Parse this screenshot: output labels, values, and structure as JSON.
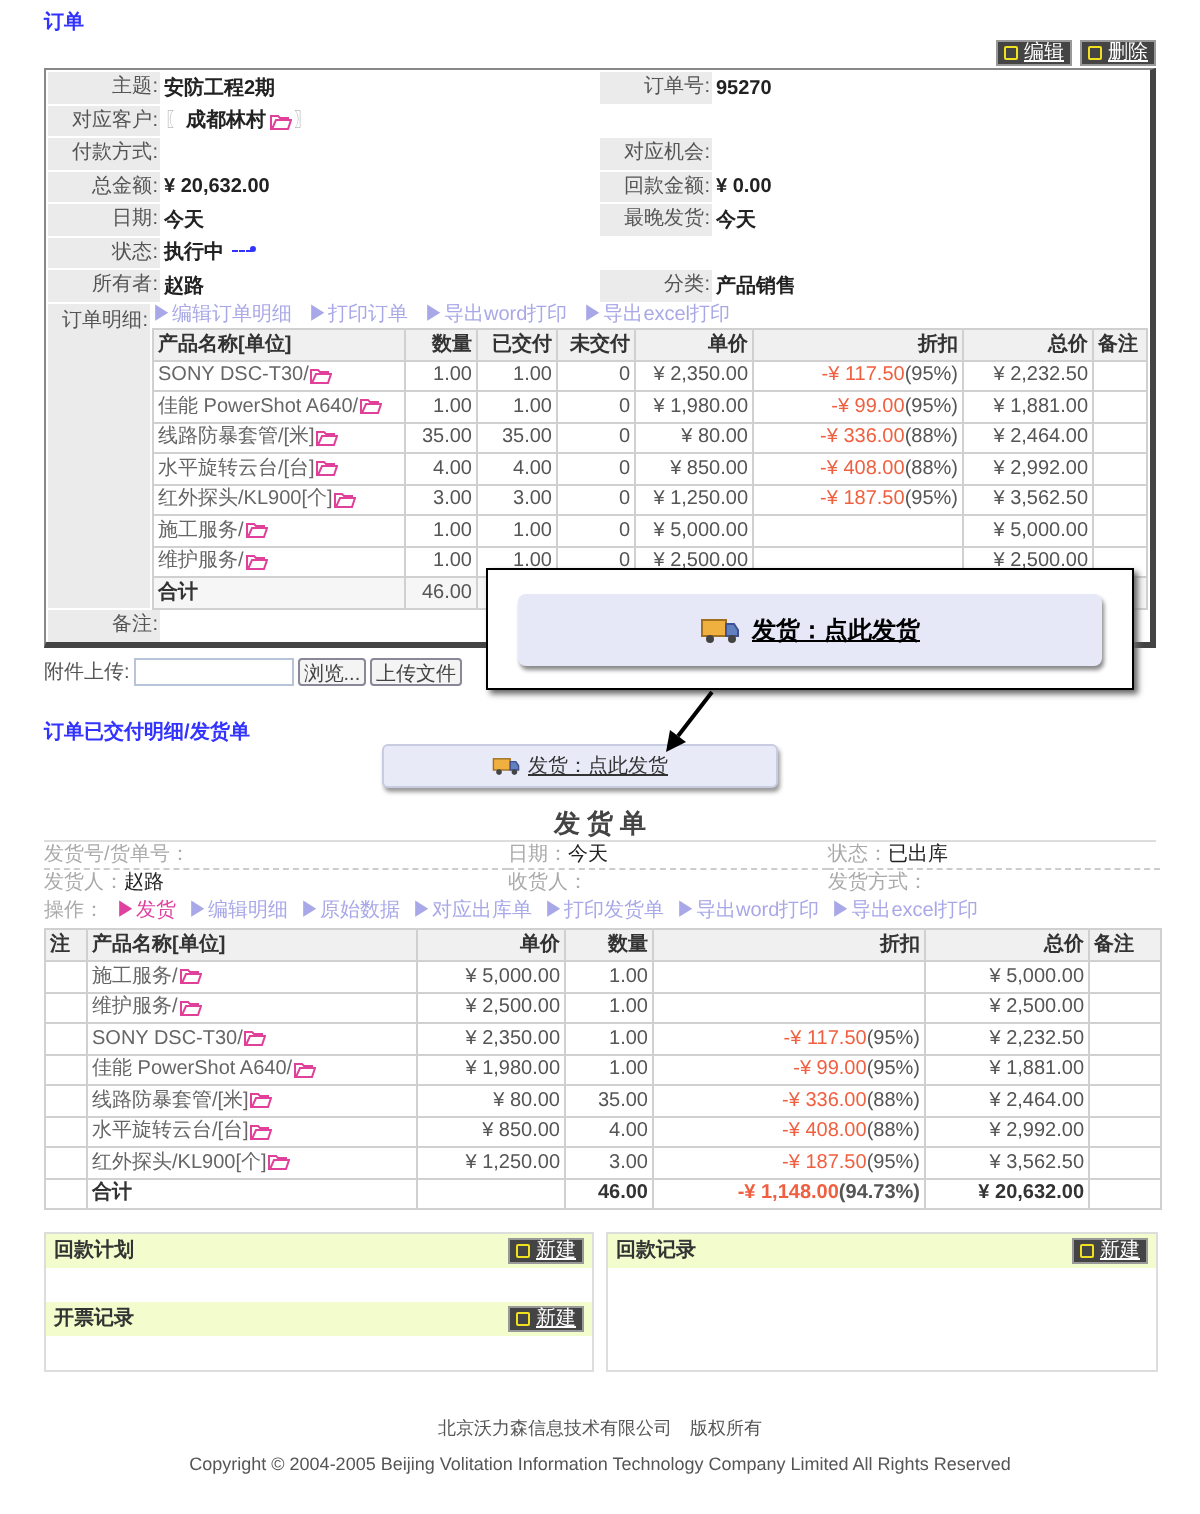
{
  "page_title": "订单",
  "toolbar": [
    {
      "label": "编辑"
    },
    {
      "label": "删除"
    }
  ],
  "order_fields": [
    {
      "cells": [
        {
          "kind": "text",
          "label": "主题:",
          "value": "安防工程2期"
        },
        {
          "kind": "text",
          "label": "订单号:",
          "value": "95270"
        }
      ]
    },
    {
      "cells": [
        {
          "kind": "customer",
          "label": "对应客户:",
          "value": "成都林村",
          "open": "〖",
          "close": "〗"
        }
      ]
    },
    {
      "cells": [
        {
          "kind": "text",
          "label": "付款方式:"
        },
        {
          "kind": "text",
          "label": "对应机会:"
        }
      ]
    },
    {
      "cells": [
        {
          "kind": "text",
          "label": "总金额:",
          "value": "¥ 20,632.00"
        },
        {
          "kind": "text",
          "label": "回款金额:",
          "value": "¥ 0.00"
        }
      ]
    },
    {
      "cells": [
        {
          "kind": "text",
          "label": "日期:",
          "value": "今天"
        },
        {
          "kind": "text",
          "label": "最晚发货:",
          "value": "今天"
        }
      ]
    },
    {
      "cells": [
        {
          "kind": "status",
          "label": "状态:",
          "value": "执行中"
        }
      ]
    },
    {
      "cells": [
        {
          "kind": "text",
          "label": "所有者:",
          "value": "赵路"
        },
        {
          "kind": "text",
          "label": "分类:",
          "value": "产品销售"
        }
      ]
    }
  ],
  "order_details": {
    "label": "订单明细:",
    "links": [
      "▶编辑订单明细",
      "▶打印订单",
      "▶导出word打印",
      "▶导出excel打印"
    ],
    "columns": [
      "**产品名称**[单位]",
      "数量",
      "已交付",
      "未交付",
      "单价",
      "折扣",
      "总价",
      "备注"
    ],
    "rows": [
      {
        "name": "SONY DSC-T30/",
        "qty": "1.00",
        "delivered": "1.00",
        "undelivered": "0",
        "price": "¥ 2,350.00",
        "discount": "-¥ 117.50",
        "pct": "(95%)",
        "total": "¥ 2,232.50"
      },
      {
        "name": "佳能  PowerShot A640/",
        "qty": "1.00",
        "delivered": "1.00",
        "undelivered": "0",
        "price": "¥ 1,980.00",
        "discount": "-¥ 99.00",
        "pct": "(95%)",
        "total": "¥ 1,881.00"
      },
      {
        "name": "线路防暴套管/[米]",
        "qty": "35.00",
        "delivered": "35.00",
        "undelivered": "0",
        "price": "¥ 80.00",
        "discount": "-¥ 336.00",
        "pct": "(88%)",
        "total": "¥ 2,464.00"
      },
      {
        "name": "水平旋转云台/[台]",
        "qty": "4.00",
        "delivered": "4.00",
        "undelivered": "0",
        "price": "¥ 850.00",
        "discount": "-¥ 408.00",
        "pct": "(88%)",
        "total": "¥ 2,992.00"
      },
      {
        "name": "红外探头/KL900[个]",
        "qty": "3.00",
        "delivered": "3.00",
        "undelivered": "0",
        "price": "¥ 1,250.00",
        "discount": "-¥ 187.50",
        "pct": "(95%)",
        "total": "¥ 3,562.50"
      },
      {
        "name": "施工服务/",
        "qty": "1.00",
        "delivered": "1.00",
        "undelivered": "0",
        "price": "¥ 5,000.00",
        "total": "¥ 5,000.00"
      },
      {
        "name": "维护服务/",
        "qty": "1.00",
        "delivered": "1.00",
        "undelivered": "0",
        "price": "¥ 2,500.00",
        "total": "¥ 2,500.00"
      }
    ],
    "total": {
      "label": "合计",
      "qty": "46.00"
    }
  },
  "remarks_label": "备注:",
  "upload": {
    "label": "附件上传:",
    "browse": "浏览...",
    "submit": "上传文件"
  },
  "section_title": "订单已交付明细/发货单",
  "ship_button": "发货：点此发货",
  "callout": {
    "label": "发货：点此发货"
  },
  "shipment": {
    "title": "发 货 单",
    "info": [
      {
        "label": "发货号/货单号："
      },
      {
        "label": "日期：",
        "value": "今天"
      },
      {
        "label": "状态：",
        "value": "已出库"
      },
      {
        "label": "发货人：",
        "value": "赵路"
      },
      {
        "label": "收货人："
      },
      {
        "label": "发货方式："
      }
    ],
    "ops_label": "操作：",
    "ops": [
      {
        "kind": "accent",
        "label": "▶发货"
      },
      {
        "kind": "link",
        "label": "▶编辑明细"
      },
      {
        "kind": "link",
        "label": "▶原始数据"
      },
      {
        "kind": "link",
        "label": "▶对应出库单"
      },
      {
        "kind": "link",
        "label": "▶打印发货单"
      },
      {
        "kind": "link",
        "label": "▶导出word打印"
      },
      {
        "kind": "link",
        "label": "▶导出excel打印"
      }
    ],
    "columns": [
      "注",
      "**产品名称**[单位]",
      "单价",
      "数量",
      "折扣",
      "总价",
      "备注"
    ],
    "rows": [
      {
        "name": "施工服务/",
        "price": "¥ 5,000.00",
        "qty": "1.00",
        "total": "¥ 5,000.00"
      },
      {
        "name": "维护服务/",
        "price": "¥ 2,500.00",
        "qty": "1.00",
        "total": "¥ 2,500.00"
      },
      {
        "name": "SONY DSC-T30/",
        "price": "¥ 2,350.00",
        "qty": "1.00",
        "discount": "-¥ 117.50",
        "pct": "(95%)",
        "total": "¥ 2,232.50"
      },
      {
        "name": "佳能  PowerShot A640/",
        "price": "¥ 1,980.00",
        "qty": "1.00",
        "discount": "-¥ 99.00",
        "pct": "(95%)",
        "total": "¥ 1,881.00"
      },
      {
        "name": "线路防暴套管/[米]",
        "price": "¥ 80.00",
        "qty": "35.00",
        "discount": "-¥ 336.00",
        "pct": "(88%)",
        "total": "¥ 2,464.00"
      },
      {
        "name": "水平旋转云台/[台]",
        "price": "¥ 850.00",
        "qty": "4.00",
        "discount": "-¥ 408.00",
        "pct": "(88%)",
        "total": "¥ 2,992.00"
      },
      {
        "name": "红外探头/KL900[个]",
        "price": "¥ 1,250.00",
        "qty": "3.00",
        "discount": "-¥ 187.50",
        "pct": "(95%)",
        "total": "¥ 3,562.50"
      }
    ],
    "total": {
      "label": "合计",
      "qty": "46.00",
      "discount": "-¥ 1,148.00",
      "pct": "(94.73%)",
      "total": "¥ 20,632.00"
    }
  },
  "panels": [
    {
      "sections": [
        {
          "title": "回款计划",
          "button": "新建"
        },
        {
          "title": "开票记录",
          "button": "新建"
        }
      ]
    },
    {
      "sections": [
        {
          "title": "回款记录",
          "button": "新建"
        }
      ]
    }
  ],
  "footer": [
    "北京沃力森信息技术有限公司　版权所有",
    "Copyright © 2004-2005 Beijing Volitation Information Technology Company Limited All Rights Reserved"
  ]
}
